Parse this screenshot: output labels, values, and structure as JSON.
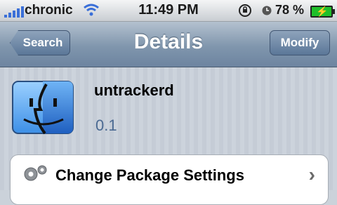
{
  "status_bar": {
    "carrier": "chronic",
    "time": "11:49 PM",
    "battery_percent": "78 %"
  },
  "navbar": {
    "back_label": "Search",
    "title": "Details",
    "action_label": "Modify"
  },
  "package": {
    "name": "untrackerd",
    "version": "0.1",
    "icon": "finder-face-icon"
  },
  "rows": {
    "settings_label": "Change Package Settings"
  }
}
